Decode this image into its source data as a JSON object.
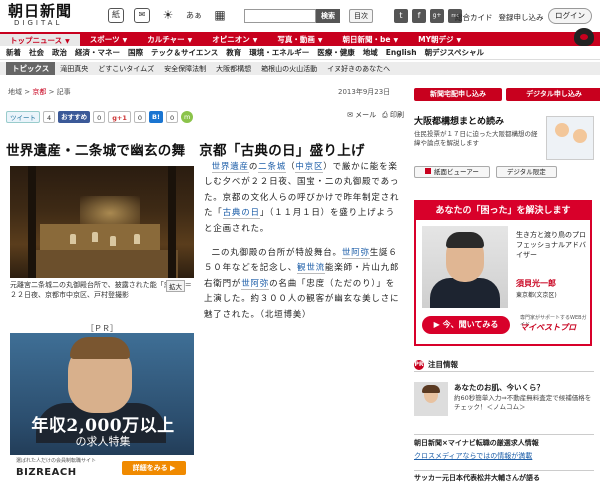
{
  "header": {
    "logo_main": "朝日新聞",
    "logo_sub": "DIGITAL",
    "icons": [
      {
        "name": "newspaper-icon",
        "glyph": "紙"
      },
      {
        "name": "mail-icon",
        "glyph": "✉"
      },
      {
        "name": "weather-icon",
        "glyph": "☀"
      },
      {
        "name": "text-size-icon",
        "glyph": "あぁ"
      },
      {
        "name": "grid-icon",
        "glyph": "▦"
      }
    ],
    "search_button": "検索",
    "toc_button": "目次",
    "social": [
      "t",
      "f",
      "g+",
      "rss"
    ],
    "links": [
      "総合カイド",
      "登録申し込み"
    ],
    "login_button": "ログイン"
  },
  "nav": {
    "items": [
      {
        "label": "トップニュース",
        "active": true
      },
      {
        "label": "スポーツ"
      },
      {
        "label": "カルチャー"
      },
      {
        "label": "オピニオン"
      },
      {
        "label": "写真・動画"
      },
      {
        "label": "朝日新聞・be"
      },
      {
        "label": "MY朝デジ"
      }
    ]
  },
  "subnav": [
    "新着",
    "社会",
    "政治",
    "経済・マネー",
    "国際",
    "テック＆サイエンス",
    "教育",
    "環境・エネルギー",
    "医療・健康",
    "地域",
    "English",
    "朝デジスペシャル"
  ],
  "topics": {
    "label": "トピックス",
    "items": [
      "滝田真央",
      "どすこいタイムズ",
      "安全保障法制",
      "大阪都構想",
      "箱根山の火山活動",
      "イヌ好きのあなたへ"
    ]
  },
  "breadcrumb": [
    "地域",
    "京都",
    "記事"
  ],
  "date": "2013年9月23日",
  "share": {
    "tweet": "ツイート",
    "tweet_count": "4",
    "fb": "おすすめ",
    "fb_count": "0",
    "gplus": "g+1",
    "gplus_count": "0",
    "hatena": "B!",
    "hatena_count": "0",
    "mixi": "m",
    "mail": "メール",
    "print": "印刷"
  },
  "article": {
    "headline": "世界遺産・二条城で幽玄の舞　京都「古典の日」盛り上げ",
    "caption": "元離宮二条城二の丸御殿台所で、披露された能「忠度」＝２２日夜、京都市中京区、戸村登撮影",
    "zoom": "拡大",
    "p1_a": "世界遺産",
    "p1_b": "の",
    "p1_c": "二条城",
    "p1_d": "（",
    "p1_e": "中京区",
    "p1_f": "）で厳かに能を楽しむ夕べが２２日夜、国宝・二の丸御殿であった。京都の文化人らの呼びかけで昨年制定された「",
    "p1_g": "古典の日",
    "p1_h": "」（１１月１日）を盛り上げようと企画された。",
    "p2_a": "二の丸御殿の台所が特設舞台。",
    "p2_b": "世阿弥",
    "p2_c": "生誕６５０年などを記念し、",
    "p2_d": "観世流",
    "p2_e": "能楽師・片山九郎右衛門が",
    "p2_f": "世阿弥",
    "p2_g": "の名曲「忠度（ただのり）」を上演した。約３００人の観客が幽玄な美しさに魅了された。（北垣博美）"
  },
  "pr": {
    "label": "［ＰＲ］",
    "big": "年収2,000万以上",
    "sub": "の求人特集",
    "tiny": "選ばれた人だけの会員制転職サイト",
    "brand": "BIZREACH",
    "cta": "詳細をみる ▶"
  },
  "right": {
    "btn1": "新聞宅配申し込み",
    "btn2": "デジタル申し込み",
    "osaka_title": "大阪都構想まとめ読み",
    "osaka_desc": "住民投票が１７日に迫った大阪都構想の経緯や論点を解説します",
    "tool1": "紙面ビューアー",
    "tool2": "デジタル限定",
    "ad_head": "あなたの「困った」を解決します",
    "ad_text": "生き方と渡り鳥のプロフェッショナルアドバイザー",
    "ad_name": "須貝光一郎",
    "ad_aff": "東京都(文京区)",
    "ad_cta": "▶ 今、聞いてみる",
    "ad_small": "専門家がサポートするWEBガイド",
    "ad_brand": "マイベストプロ",
    "attn_label": "注目情報",
    "attn_title": "あなたのお肌、今いくら？",
    "attn_desc": "約60秒簡単入力⇒不動産無料査定で候補価格をチェック！＜ノムコム＞",
    "ads_t1": "朝日新聞×マイナビ転職の厳選求人情報",
    "ads_t2": "クロスメディアならではの情報が満載",
    "news": "サッカー元日本代表松井大輔さんが語る"
  }
}
